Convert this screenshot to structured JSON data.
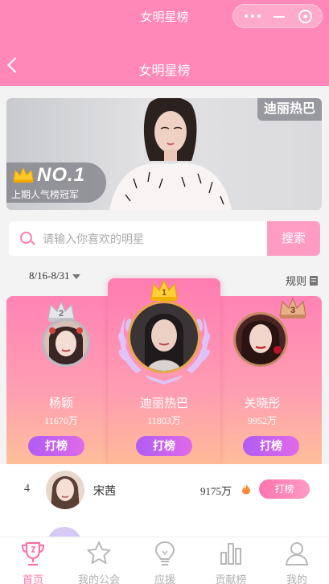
{
  "app": {
    "title": "女明星榜",
    "nav_title": "女明星榜"
  },
  "banner": {
    "star_name": "迪丽热巴",
    "badge_rank": "NO.1",
    "badge_text": "上期人气榜冠军"
  },
  "search": {
    "placeholder": "请输入你喜欢的明星",
    "button_label": "搜索"
  },
  "period": {
    "label": "8/16-8/31"
  },
  "rules_label": "规则",
  "podium": [
    {
      "rank": "1",
      "name": "迪丽热巴",
      "votes": "11803万",
      "button": "打榜"
    },
    {
      "rank": "2",
      "name": "杨颖",
      "votes": "11670万",
      "button": "打榜"
    },
    {
      "rank": "3",
      "name": "关晓彤",
      "votes": "9952万",
      "button": "打榜"
    }
  ],
  "list": [
    {
      "rank": "4",
      "name": "宋茜",
      "votes": "9175万",
      "button": "打榜"
    }
  ],
  "tabs": [
    {
      "label": "首页",
      "icon": "trophy-icon",
      "active": true
    },
    {
      "label": "我的公会",
      "icon": "star-icon",
      "active": false
    },
    {
      "label": "应援",
      "icon": "lightbulb-icon",
      "active": false
    },
    {
      "label": "贡献榜",
      "icon": "bar-chart-icon",
      "active": false
    },
    {
      "label": "我的",
      "icon": "user-icon",
      "active": false
    }
  ],
  "colors": {
    "accent": "#ff88b8",
    "vote_button": "#b05cf4",
    "active_tab": "#ff6fa8"
  }
}
